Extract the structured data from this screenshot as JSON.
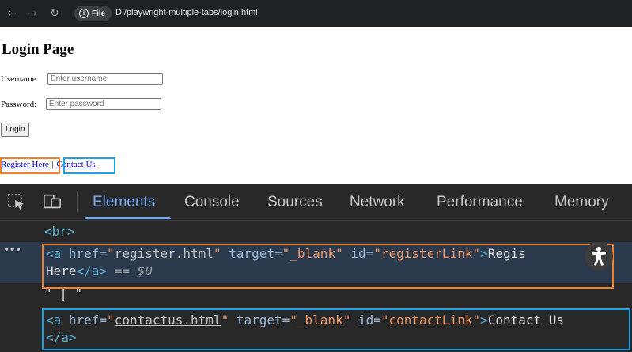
{
  "browser": {
    "back_icon": "←",
    "forward_icon": "→",
    "reload_icon": "↻",
    "site_chip_label": "File",
    "info_icon": "i",
    "url": "D:/playwright-multiple-tabs/login.html"
  },
  "page": {
    "title": "Login Page",
    "username_label": "Username:",
    "username_placeholder": "Enter username",
    "password_label": "Password:",
    "password_placeholder": "Enter password",
    "login_button": "Login",
    "register_link": "Register Here",
    "separator": "|",
    "contact_link": "Contact Us"
  },
  "devtools": {
    "tabs": [
      "Elements",
      "Console",
      "Sources",
      "Network",
      "Performance",
      "Memory"
    ],
    "active_tab": "Elements",
    "code": {
      "br": "<br>",
      "a_open": "<a",
      "href_attr": " href=",
      "target_attr": " target=",
      "id_attr": " id=",
      "close_bracket": ">",
      "quote": "\"",
      "register_href": "register.html",
      "target_val": "\"_blank\"",
      "register_id": "\"registerLink\"",
      "register_text_1": "Regis",
      "register_text_2": "Here",
      "a_close": "</a>",
      "selected_marker": "== $0",
      "text_node": "\" | \"",
      "contact_href": "contactus.html",
      "contact_id": "\"contactLink\"",
      "contact_text": "Contact Us",
      "row_menu": "•••"
    },
    "a11y_icon": "🯅"
  },
  "highlight_colors": {
    "register": "#f0812b",
    "contact": "#1fa0e4"
  }
}
